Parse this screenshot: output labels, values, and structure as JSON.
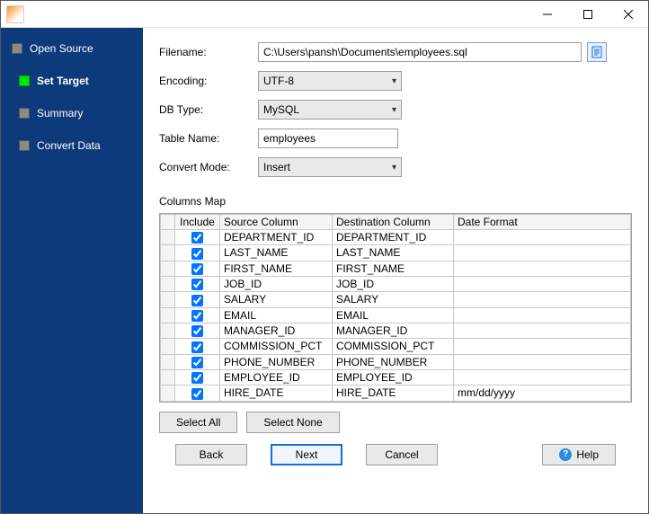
{
  "titlebar": {
    "title": ""
  },
  "sidebar": {
    "items": [
      {
        "label": "Open Source",
        "active": false
      },
      {
        "label": "Set Target",
        "active": true
      },
      {
        "label": "Summary",
        "active": false
      },
      {
        "label": "Convert Data",
        "active": false
      }
    ]
  },
  "form": {
    "filename_label": "Filename:",
    "filename_value": "C:\\Users\\pansh\\Documents\\employees.sql",
    "encoding_label": "Encoding:",
    "encoding_value": "UTF-8",
    "dbtype_label": "DB Type:",
    "dbtype_value": "MySQL",
    "tablename_label": "Table Name:",
    "tablename_value": "employees",
    "convertmode_label": "Convert Mode:",
    "convertmode_value": "Insert"
  },
  "columns_map": {
    "heading": "Columns Map",
    "headers": {
      "include": "Include",
      "source": "Source Column",
      "destination": "Destination Column",
      "date_format": "Date Format"
    },
    "rows": [
      {
        "include": true,
        "source": "DEPARTMENT_ID",
        "destination": "DEPARTMENT_ID",
        "date_format": ""
      },
      {
        "include": true,
        "source": "LAST_NAME",
        "destination": "LAST_NAME",
        "date_format": ""
      },
      {
        "include": true,
        "source": "FIRST_NAME",
        "destination": "FIRST_NAME",
        "date_format": ""
      },
      {
        "include": true,
        "source": "JOB_ID",
        "destination": "JOB_ID",
        "date_format": ""
      },
      {
        "include": true,
        "source": "SALARY",
        "destination": "SALARY",
        "date_format": ""
      },
      {
        "include": true,
        "source": "EMAIL",
        "destination": "EMAIL",
        "date_format": ""
      },
      {
        "include": true,
        "source": "MANAGER_ID",
        "destination": "MANAGER_ID",
        "date_format": ""
      },
      {
        "include": true,
        "source": "COMMISSION_PCT",
        "destination": "COMMISSION_PCT",
        "date_format": ""
      },
      {
        "include": true,
        "source": "PHONE_NUMBER",
        "destination": "PHONE_NUMBER",
        "date_format": ""
      },
      {
        "include": true,
        "source": "EMPLOYEE_ID",
        "destination": "EMPLOYEE_ID",
        "date_format": ""
      },
      {
        "include": true,
        "source": "HIRE_DATE",
        "destination": "HIRE_DATE",
        "date_format": "mm/dd/yyyy"
      }
    ]
  },
  "buttons": {
    "select_all": "Select All",
    "select_none": "Select None",
    "back": "Back",
    "next": "Next",
    "cancel": "Cancel",
    "help": "Help"
  }
}
